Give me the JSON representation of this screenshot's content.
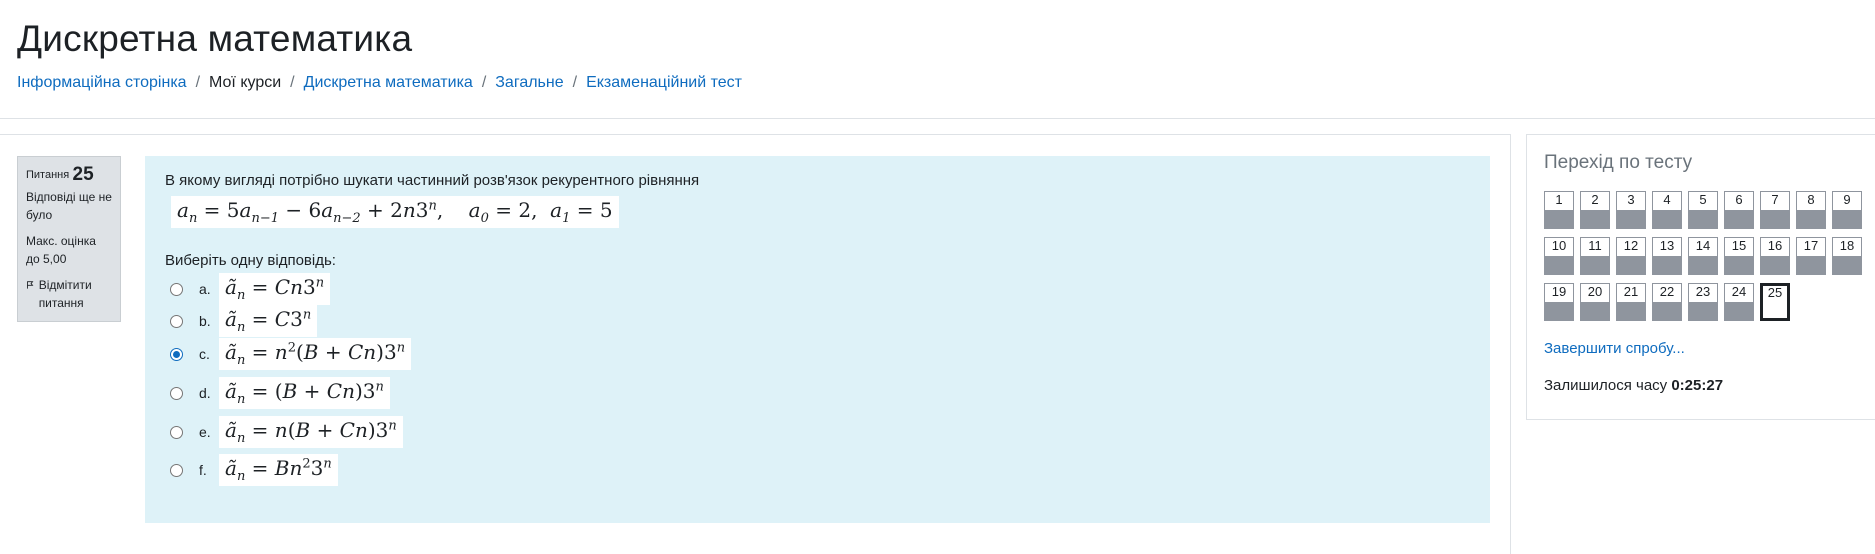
{
  "page_title": "Дискретна математика",
  "breadcrumb": [
    {
      "label": "Інформаційна сторінка",
      "link": true
    },
    {
      "label": "Мої курси",
      "link": false
    },
    {
      "label": "Дискретна математика",
      "link": true
    },
    {
      "label": "Загальне",
      "link": true
    },
    {
      "label": "Екзаменаційний тест",
      "link": true
    }
  ],
  "question_info": {
    "label": "Питання",
    "number": "25",
    "state": "Відповіді ще не було",
    "grade": "Макс. оцінка до 5,00",
    "flag_label": "Відмітити питання"
  },
  "question": {
    "text": "В якому вигляді потрібно шукати частинний розв'язок рекурентного рівняння",
    "prompt": "Виберіть одну відповідь:",
    "selected": "c",
    "answers": [
      {
        "letter": "a."
      },
      {
        "letter": "b."
      },
      {
        "letter": "c."
      },
      {
        "letter": "d."
      },
      {
        "letter": "e."
      },
      {
        "letter": "f."
      }
    ]
  },
  "quiz_nav": {
    "title": "Перехід по тесту",
    "buttons": [
      "1",
      "2",
      "3",
      "4",
      "5",
      "6",
      "7",
      "8",
      "9",
      "10",
      "11",
      "12",
      "13",
      "14",
      "15",
      "16",
      "17",
      "18",
      "19",
      "20",
      "21",
      "22",
      "23",
      "24",
      "25"
    ],
    "current": "25",
    "finish_label": "Завершити спробу...",
    "timer_label": "Залишилося часу",
    "timer_value": "0:25:27"
  },
  "colors": {
    "link": "#0f6cbf",
    "question_bg": "#def2f8",
    "info_bg": "#dee2e6",
    "nav_fill": "#8f959e"
  }
}
